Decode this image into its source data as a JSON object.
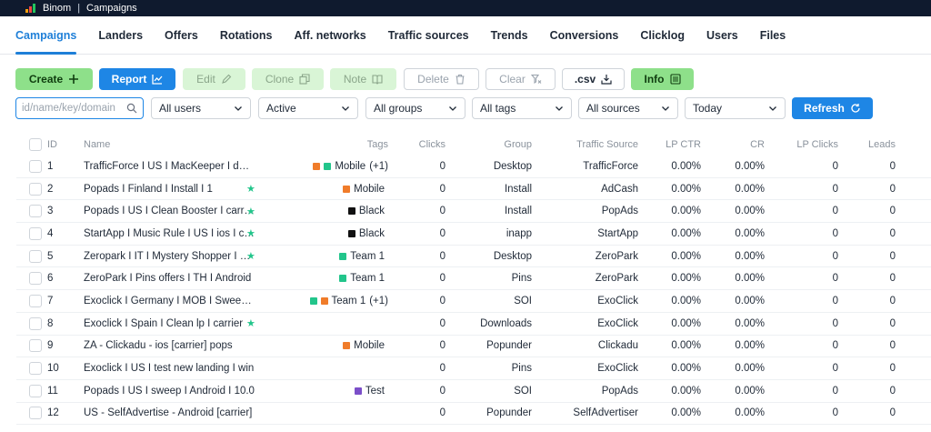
{
  "app": {
    "name": "Binom",
    "section": "Campaigns",
    "separator": "|"
  },
  "nav": [
    {
      "label": "Campaigns",
      "active": true
    },
    {
      "label": "Landers"
    },
    {
      "label": "Offers"
    },
    {
      "label": "Rotations"
    },
    {
      "label": "Aff. networks"
    },
    {
      "label": "Traffic sources"
    },
    {
      "label": "Trends"
    },
    {
      "label": "Conversions"
    },
    {
      "label": "Clicklog"
    },
    {
      "label": "Users"
    },
    {
      "label": "Files"
    }
  ],
  "toolbar": {
    "create": "Create",
    "report": "Report",
    "edit": "Edit",
    "clone": "Clone",
    "note": "Note",
    "delete": "Delete",
    "clear": "Clear",
    "csv": ".csv",
    "info": "Info"
  },
  "filters": {
    "search_placeholder": "id/name/key/domain",
    "users": "All users",
    "status": "Active",
    "groups": "All groups",
    "tags": "All tags",
    "sources": "All sources",
    "date": "Today",
    "refresh": "Refresh"
  },
  "table": {
    "columns": {
      "id": "ID",
      "name": "Name",
      "tags": "Tags",
      "clicks": "Clicks",
      "group": "Group",
      "traffic_source": "Traffic Source",
      "lp_ctr": "LP CTR",
      "cr": "CR",
      "lp_clicks": "LP Clicks",
      "leads": "Leads"
    },
    "rows": [
      {
        "id": "1",
        "name": "TrafficForce I US I MacKeeper I desktop",
        "star": "",
        "tags": [
          {
            "color": "#f07c2a"
          },
          {
            "color": "#22c58b"
          }
        ],
        "tag_label": "Mobile",
        "tag_extra": "(+1)",
        "clicks": "0",
        "group": "Desktop",
        "source": "TrafficForce",
        "lp_ctr": "0.00%",
        "cr": "0.00%",
        "lp_clicks": "0",
        "leads": "0"
      },
      {
        "id": "2",
        "name": "Popads I Finland I Install I 1",
        "star": "★",
        "tags": [
          {
            "color": "#f07c2a"
          }
        ],
        "tag_label": "Mobile",
        "tag_extra": "",
        "clicks": "0",
        "group": "Install",
        "source": "AdCash",
        "lp_ctr": "0.00%",
        "cr": "0.00%",
        "lp_clicks": "0",
        "leads": "0"
      },
      {
        "id": "3",
        "name": "Popads I US I Clean Booster I carrier",
        "star": "★",
        "tags": [
          {
            "color": "#111111"
          }
        ],
        "tag_label": "Black",
        "tag_extra": "",
        "clicks": "0",
        "group": "Install",
        "source": "PopAds",
        "lp_ctr": "0.00%",
        "cr": "0.00%",
        "lp_clicks": "0",
        "leads": "0"
      },
      {
        "id": "4",
        "name": "StartApp I Music Rule I US I ios I carrier",
        "star": "★",
        "tags": [
          {
            "color": "#111111"
          }
        ],
        "tag_label": "Black",
        "tag_extra": "",
        "clicks": "0",
        "group": "inapp",
        "source": "StartApp",
        "lp_ctr": "0.00%",
        "cr": "0.00%",
        "lp_clicks": "0",
        "leads": "0"
      },
      {
        "id": "5",
        "name": "Zeropark I IT I Mystery Shopper I mobile",
        "star": "★",
        "tags": [
          {
            "color": "#22c58b"
          }
        ],
        "tag_label": "Team 1",
        "tag_extra": "",
        "clicks": "0",
        "group": "Desktop",
        "source": "ZeroPark",
        "lp_ctr": "0.00%",
        "cr": "0.00%",
        "lp_clicks": "0",
        "leads": "0"
      },
      {
        "id": "6",
        "name": "ZeroPark I Pins offers I TH I Android",
        "star": "",
        "tags": [
          {
            "color": "#22c58b"
          }
        ],
        "tag_label": "Team 1",
        "tag_extra": "",
        "clicks": "0",
        "group": "Pins",
        "source": "ZeroPark",
        "lp_ctr": "0.00%",
        "cr": "0.00%",
        "lp_clicks": "0",
        "leads": "0"
      },
      {
        "id": "7",
        "name": "Exoclick I Germany I MOB I Sweepstakes",
        "star": "",
        "tags": [
          {
            "color": "#22c58b"
          },
          {
            "color": "#f07c2a"
          }
        ],
        "tag_label": "Team 1",
        "tag_extra": "(+1)",
        "clicks": "0",
        "group": "SOI",
        "source": "ExoClick",
        "lp_ctr": "0.00%",
        "cr": "0.00%",
        "lp_clicks": "0",
        "leads": "0"
      },
      {
        "id": "8",
        "name": "Exoclick I Spain I Clean lp I carrier",
        "star": "★",
        "tags": [],
        "tag_label": "",
        "tag_extra": "",
        "clicks": "0",
        "group": "Downloads",
        "source": "ExoClick",
        "lp_ctr": "0.00%",
        "cr": "0.00%",
        "lp_clicks": "0",
        "leads": "0"
      },
      {
        "id": "9",
        "name": "ZA - Clickadu - ios [carrier] pops",
        "star": "",
        "tags": [
          {
            "color": "#f07c2a"
          }
        ],
        "tag_label": "Mobile",
        "tag_extra": "",
        "clicks": "0",
        "group": "Popunder",
        "source": "Clickadu",
        "lp_ctr": "0.00%",
        "cr": "0.00%",
        "lp_clicks": "0",
        "leads": "0"
      },
      {
        "id": "10",
        "name": "Exoclick I US I test new landing I win",
        "star": "",
        "tags": [],
        "tag_label": "",
        "tag_extra": "",
        "clicks": "0",
        "group": "Pins",
        "source": "ExoClick",
        "lp_ctr": "0.00%",
        "cr": "0.00%",
        "lp_clicks": "0",
        "leads": "0"
      },
      {
        "id": "11",
        "name": "Popads I US I sweep I Android I 10.0",
        "star": "",
        "tags": [
          {
            "color": "#7b4fc9"
          }
        ],
        "tag_label": "Test",
        "tag_extra": "",
        "clicks": "0",
        "group": "SOI",
        "source": "PopAds",
        "lp_ctr": "0.00%",
        "cr": "0.00%",
        "lp_clicks": "0",
        "leads": "0"
      },
      {
        "id": "12",
        "name": "US - SelfAdvertise - Android [carrier]",
        "star": "",
        "tags": [],
        "tag_label": "",
        "tag_extra": "",
        "clicks": "0",
        "group": "Popunder",
        "source": "SelfAdvertiser",
        "lp_ctr": "0.00%",
        "cr": "0.00%",
        "lp_clicks": "0",
        "leads": "0"
      }
    ]
  },
  "colors": {
    "accent": "#1e86e5",
    "green": "#8ee08a",
    "topbar": "#0f1a2e"
  }
}
